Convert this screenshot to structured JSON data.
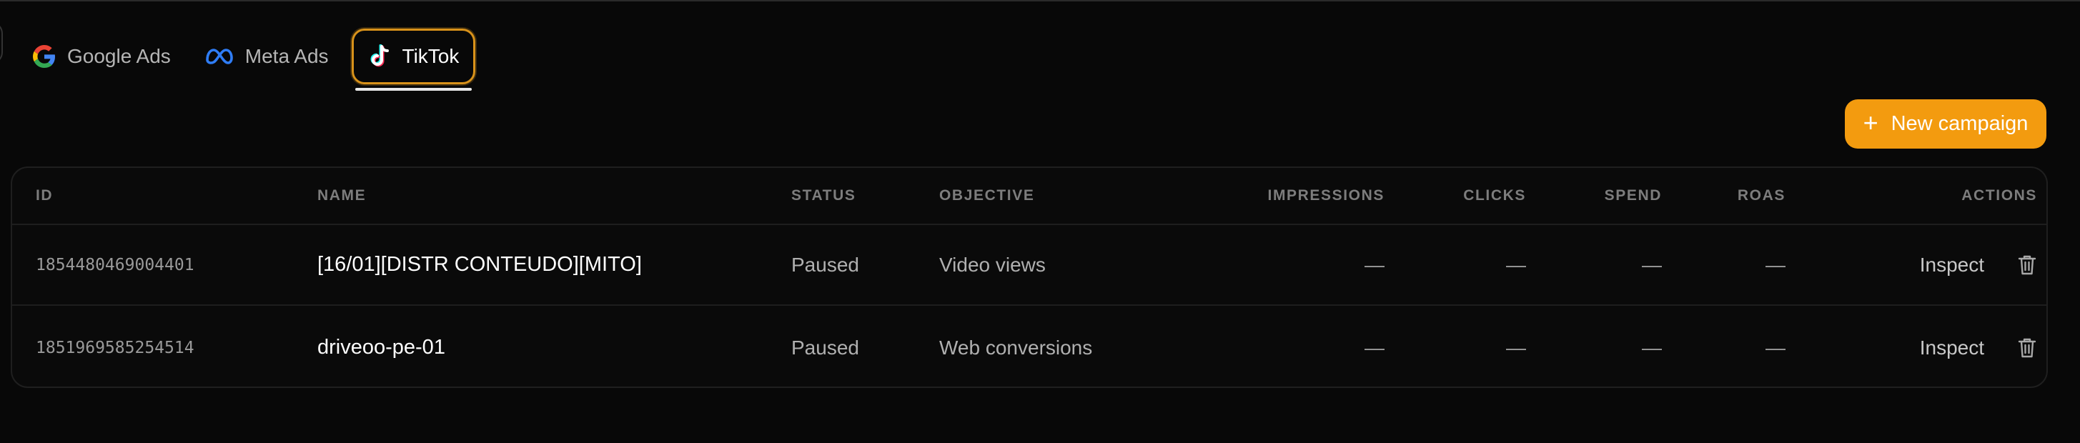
{
  "tabs": [
    {
      "label": "Google Ads",
      "icon": "google-icon",
      "active": false
    },
    {
      "label": "Meta Ads",
      "icon": "meta-icon",
      "active": false
    },
    {
      "label": "TikTok",
      "icon": "tiktok-icon",
      "active": true
    }
  ],
  "toolbar": {
    "new_campaign_label": "New campaign",
    "new_campaign_icon": "plus-icon"
  },
  "colors": {
    "accent": "#f39b0f",
    "active_tab_border": "#d8921a",
    "background": "#080808"
  },
  "table": {
    "headers": {
      "id": "ID",
      "name": "NAME",
      "status": "STATUS",
      "objective": "OBJECTIVE",
      "impressions": "IMPRESSIONS",
      "clicks": "CLICKS",
      "spend": "SPEND",
      "roas": "ROAS",
      "actions": "ACTIONS"
    },
    "rows": [
      {
        "id": "1854480469004401",
        "name": "[16/01][DISTR CONTEUDO][MITO]",
        "status": "Paused",
        "objective": "Video views",
        "impressions": "—",
        "clicks": "—",
        "spend": "—",
        "roas": "—",
        "inspect_label": "Inspect",
        "delete_icon": "trash-icon"
      },
      {
        "id": "1851969585254514",
        "name": "driveoo-pe-01",
        "status": "Paused",
        "objective": "Web conversions",
        "impressions": "—",
        "clicks": "—",
        "spend": "—",
        "roas": "—",
        "inspect_label": "Inspect",
        "delete_icon": "trash-icon"
      }
    ]
  }
}
